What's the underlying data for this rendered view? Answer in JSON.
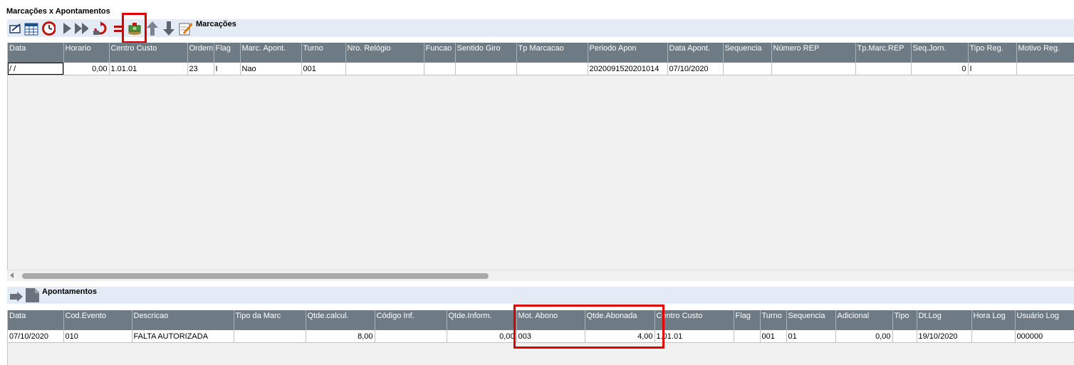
{
  "window_title": "Marcações x Apontamentos",
  "marcacoes": {
    "label": "Marcações",
    "toolbar_icons": [
      "edit-icon",
      "calendar-icon",
      "clock-icon",
      "play-icon",
      "fast-forward-icon",
      "undo-icon",
      "equals-icon",
      "money-icon",
      "arrow-up-icon",
      "arrow-down-icon",
      "pencil-note-icon"
    ],
    "columns": [
      "Data",
      "Horario",
      "Centro Custo",
      "Ordem",
      "Flag",
      "Marc. Apont.",
      "Turno",
      "Nro. Relógio",
      "Funcao",
      "Sentido Giro",
      "Tp Marcacao",
      "Periodo Apon",
      "Data Apont.",
      "Sequencia",
      "Número REP",
      "Tp.Marc.REP",
      "Seq.Jorn.",
      "Tipo Reg.",
      "Motivo Reg."
    ],
    "rows": [
      [
        " /  /",
        "0,00",
        "1.01.01",
        "23",
        "I",
        "Nao",
        "001",
        "",
        "",
        "",
        "",
        "2020091520201014",
        "07/10/2020",
        "",
        "",
        "",
        "0",
        "I",
        ""
      ]
    ]
  },
  "apontamentos": {
    "label": "Apontamentos",
    "toolbar_icons": [
      "forward-arrow-icon",
      "document-icon"
    ],
    "columns": [
      "Data",
      "Cod.Evento",
      "Descricao",
      "Tipo da Marc",
      "Qtde.calcul.",
      "Código Inf.",
      "Qtde.Inform.",
      "Mot. Abono",
      "Qtde.Abonada",
      "Centro Custo",
      "Flag",
      "Turno",
      "Sequencia",
      "Adicional",
      "Tipo",
      "Dt.Log",
      "Hora Log",
      "Usuário Log"
    ],
    "rows": [
      [
        "07/10/2020",
        "010",
        "FALTA AUTORIZADA",
        "",
        "8,00",
        "",
        "0,00",
        "003",
        "4,00",
        "1.01.01",
        "",
        "001",
        "01",
        "0,00",
        "",
        "19/10/2020",
        "",
        "000000"
      ]
    ]
  },
  "colors": {
    "header_bg": "#6f7b84",
    "toolbar_bg": "#e3ebf5",
    "highlight": "#e00000"
  }
}
